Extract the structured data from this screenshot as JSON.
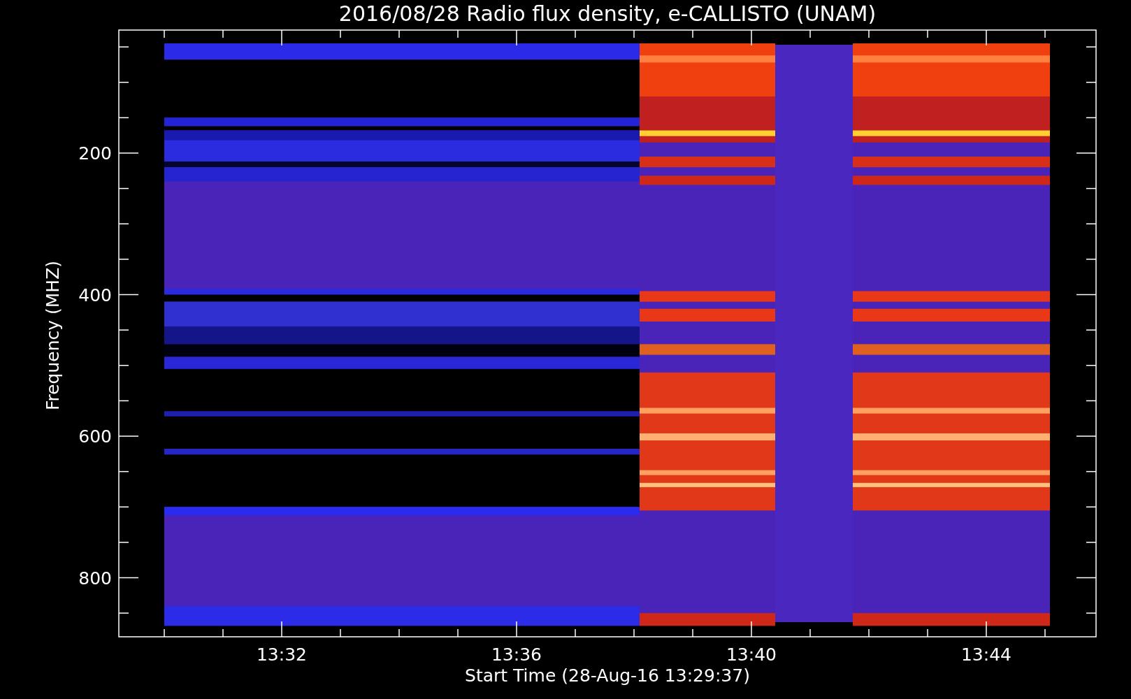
{
  "plot": {
    "title": "2016/08/28  Radio flux density, e-CALLISTO (UNAM)",
    "xlabel": "Start Time (28-Aug-16 13:29:37)",
    "ylabel": "Frequency (MHZ)",
    "xticks": [
      "13:32",
      "13:36",
      "13:40",
      "13:44"
    ],
    "yticks": [
      "200",
      "400",
      "600",
      "800"
    ]
  }
}
